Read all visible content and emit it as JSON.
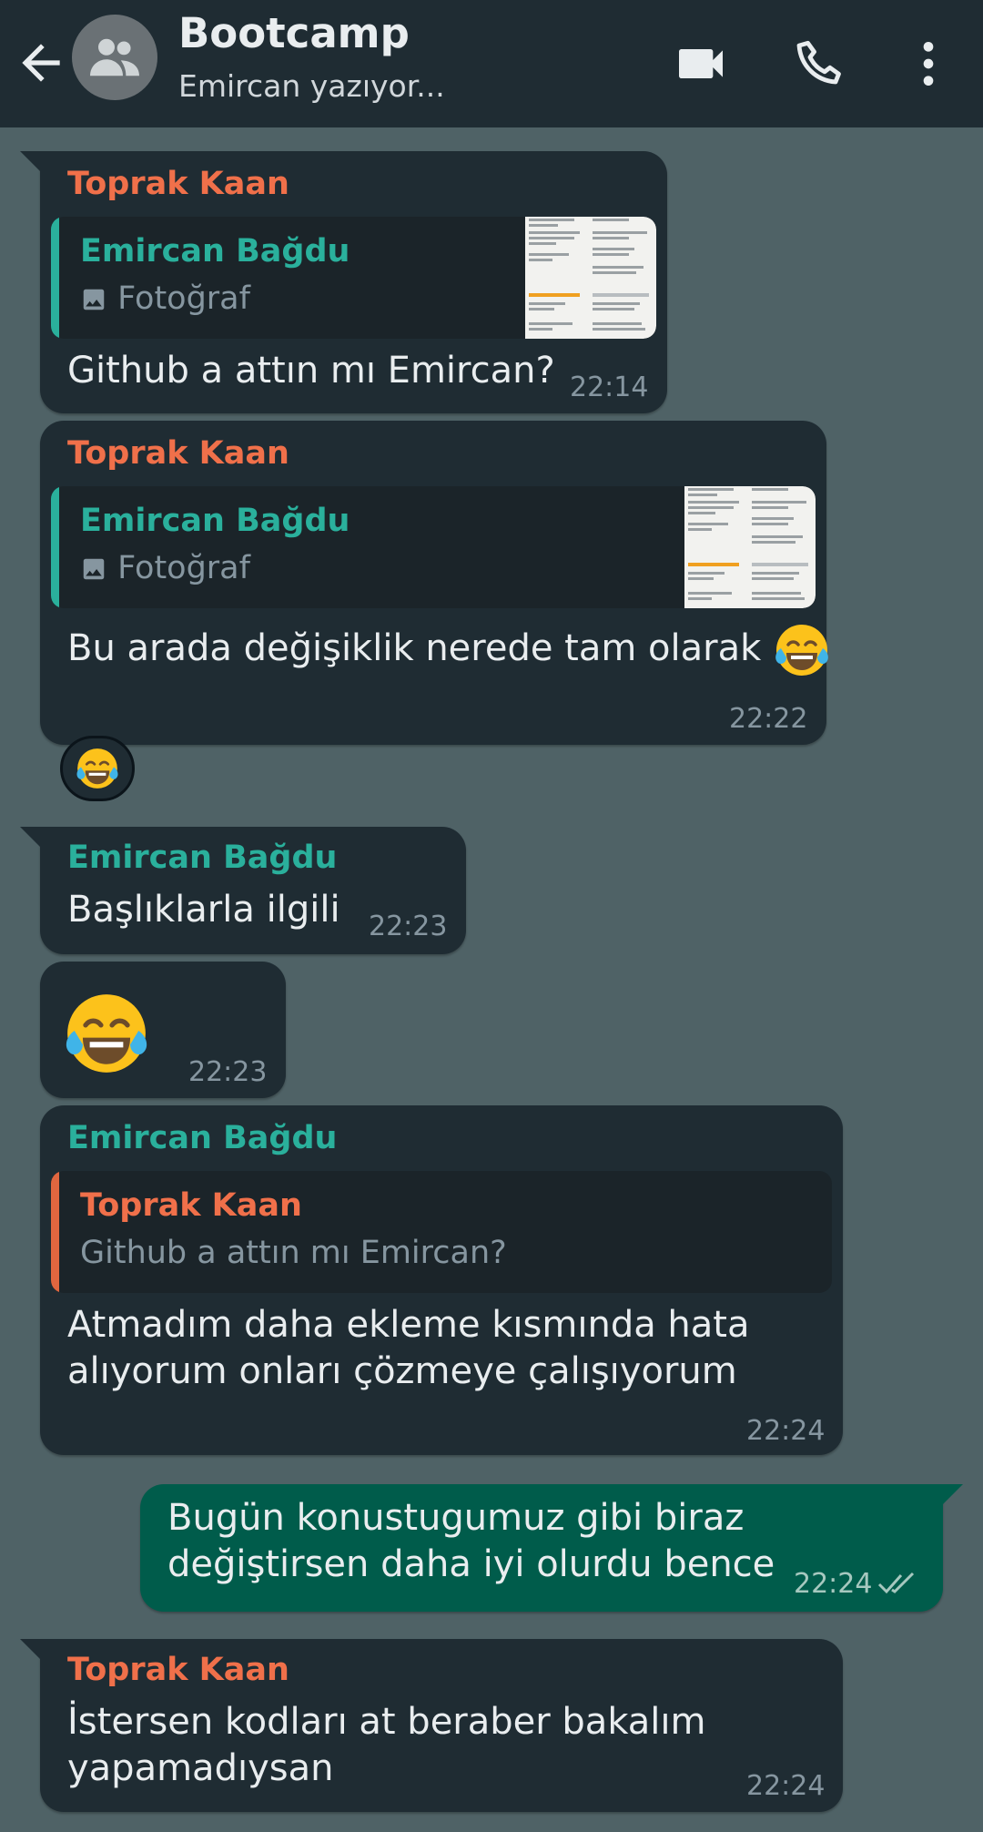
{
  "header": {
    "title": "Bootcamp",
    "status": "Emircan yazıyor..."
  },
  "colors": {
    "header_bg": "#1f2c33",
    "chat_bg": "#4f6266",
    "incoming_bubble": "#1f2c33",
    "outgoing_bubble": "#005c4b",
    "sender_orange": "#f0704a",
    "sender_teal": "#2ab09c"
  },
  "icons": {
    "back": "arrow-left-icon",
    "avatar": "group-icon",
    "video": "video-call-icon",
    "call": "phone-icon",
    "menu": "more-vert-icon",
    "photo": "image-icon",
    "emoji": "face-with-tears-of-joy",
    "read": "double-check-icon"
  },
  "messages": [
    {
      "sender": "Toprak Kaan",
      "quote": {
        "name": "Emircan Bağdu",
        "text": "Fotoğraf"
      },
      "text": "Github a attın mı Emircan?",
      "time": "22:14"
    },
    {
      "sender": "Toprak Kaan",
      "quote": {
        "name": "Emircan Bağdu",
        "text": "Fotoğraf"
      },
      "text": "Bu arada değişiklik nerede tam olarak",
      "time": "22:22"
    },
    {
      "sender": "Emircan Bağdu",
      "text": "Başlıklarla ilgili",
      "time": "22:23"
    },
    {
      "time": "22:23"
    },
    {
      "sender": "Emircan Bağdu",
      "quote": {
        "name": "Toprak Kaan",
        "text": "Github a attın mı Emircan?"
      },
      "line1": "Atmadım daha ekleme kısmında hata",
      "line2": "alıyorum onları çözmeye çalışıyorum",
      "time": "22:24"
    },
    {
      "line1": "Bugün konustugumuz gibi biraz",
      "line2": "değiştirsen daha iyi olurdu bence",
      "time": "22:24"
    },
    {
      "sender": "Toprak Kaan",
      "line1": "İstersen kodları at beraber bakalım",
      "line2": "yapamadıysan",
      "time": "22:24"
    }
  ]
}
